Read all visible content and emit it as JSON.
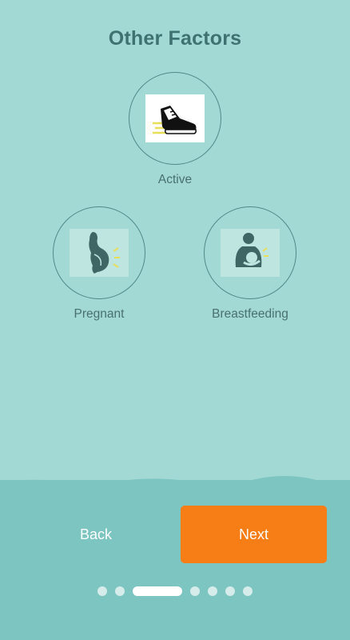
{
  "page": {
    "title": "Other Factors"
  },
  "factors": [
    {
      "label": "Active",
      "icon": "sneaker-icon"
    },
    {
      "label": "Pregnant",
      "icon": "pregnant-icon"
    },
    {
      "label": "Breastfeeding",
      "icon": "breastfeeding-icon"
    }
  ],
  "nav": {
    "back_label": "Back",
    "next_label": "Next"
  },
  "pagination": {
    "total": 7,
    "current": 3
  },
  "colors": {
    "background": "#a3d9d5",
    "footer": "#7cc5c0",
    "accent": "#f77d16",
    "text": "#3e7271"
  }
}
